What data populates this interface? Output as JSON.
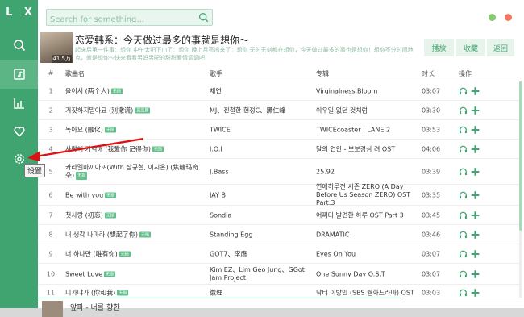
{
  "app": {
    "logo": "L X"
  },
  "search": {
    "placeholder": "Search for something..."
  },
  "nav": {
    "items": [
      {
        "name": "search",
        "icon": "search-icon"
      },
      {
        "name": "song-list",
        "icon": "music-list-icon"
      },
      {
        "name": "leaderboard",
        "icon": "chart-bar-icon"
      },
      {
        "name": "my-list",
        "icon": "heart-icon"
      },
      {
        "name": "settings",
        "icon": "gear-icon"
      }
    ],
    "tooltip": "设置"
  },
  "now_playing": {
    "cover_count": "41.5万",
    "title": "恋爱韩系：今天做过最多的事就是想你～",
    "description": "起床后第一件事：想你 中午太阳下山了：想你 晚上月亮出来了：想你 无时无刻都在想你，今天做过最多的事也是想你！想你不分时间地点，就是想你～快来看看另妈另配的甜甜爱情调调吧！"
  },
  "header_buttons": {
    "play": "播放",
    "collect": "收藏",
    "back": "返回"
  },
  "table": {
    "columns": {
      "num": "#",
      "name": "歌曲名",
      "singer": "歌手",
      "album": "专辑",
      "time": "时长",
      "ops": "操作"
    },
    "rows": [
      {
        "num": "1",
        "name": "올이서 (两个人)",
        "tag": "无损",
        "singer": "채연",
        "album": "Virginalness.Bloom",
        "time": "03:07"
      },
      {
        "num": "2",
        "name": "거짓하지말아요 (别撒谎)",
        "tag": "高品质",
        "singer": "MJ、진철한 현정C、黑仁峰",
        "album": "이우일 없던 것처럼",
        "time": "03:30"
      },
      {
        "num": "3",
        "name": "녹아요 (融化)",
        "tag": "无损",
        "singer": "TWICE",
        "album": "TWICEcoaster : LANE 2",
        "time": "03:53"
      },
      {
        "num": "4",
        "name": "사랑해 기억해 (我爱你 记得你)",
        "tag": "无损",
        "singer": "I.O.I",
        "album": "달의 연인 - 보보경심 려 OST",
        "time": "04:06"
      },
      {
        "num": "5",
        "name": "카라멜마끼아또(With 장규철, 이시온) (焦糖玛奇朵)",
        "tag": "无损",
        "singer": "J.Bass",
        "album": "25.92",
        "time": "03:39"
      },
      {
        "num": "6",
        "name": "Be with you",
        "tag": "无损",
        "singer": "JAY B",
        "album": "연애하루전 시즌 ZERO (A Day Before Us Season ZERO) OST Part.3",
        "time": "03:35"
      },
      {
        "num": "7",
        "name": "첫사랑 (初恋)",
        "tag": "无损",
        "singer": "Sondia",
        "album": "어쩌다 발견한 하루 OST Part 3",
        "time": "03:45"
      },
      {
        "num": "8",
        "name": "내 생각 나마라 (想起了你)",
        "tag": "无损",
        "singer": "Standing Egg",
        "album": "DRAMATIC",
        "time": "03:46"
      },
      {
        "num": "9",
        "name": "너 하나만 (唯有你)",
        "tag": "无损",
        "singer": "GOT7、李膺",
        "album": "Eyes On You",
        "time": "03:07"
      },
      {
        "num": "10",
        "name": "Sweet Love",
        "tag": "无损",
        "singer": "Kim EZ、Lim Geo Jung、GGot Jam Project",
        "album": "One Sunny Day O.S.T",
        "time": "03:07"
      },
      {
        "num": "11",
        "name": "니가냐가 (你和我)",
        "tag": "无损",
        "singer": "徽理",
        "album": "닥터 이방인 (SBS 월화드라마) OST",
        "time": "03:03"
      }
    ]
  },
  "player": {
    "title": "앞파 - 너를 향한"
  },
  "colors": {
    "brand": "#3fa46f",
    "accent_light": "#e6f4ec",
    "dot_green": "#85c96f",
    "dot_red": "#f27761"
  }
}
